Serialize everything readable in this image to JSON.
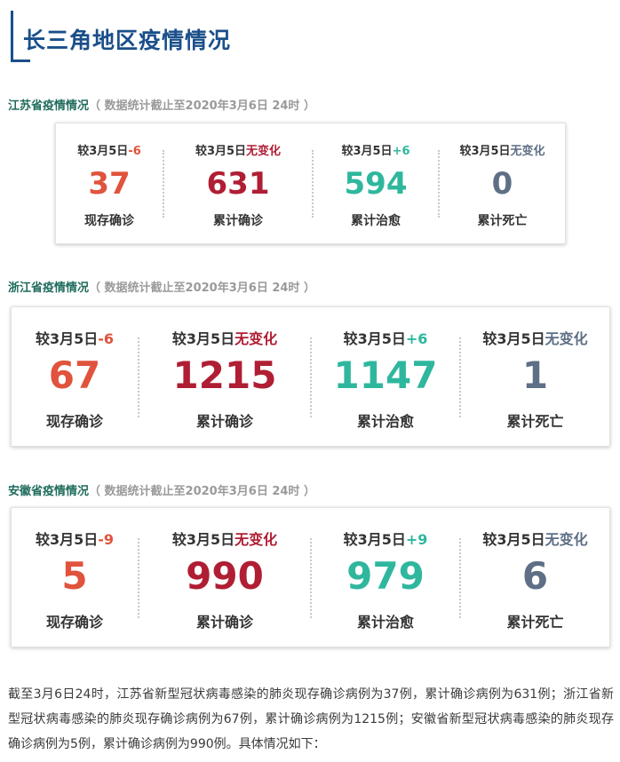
{
  "title": "长三角地区疫情情况",
  "sections": [
    {
      "name": "江苏省疫情情况",
      "note": "（ 数据统计截止至2020年3月6日 24时 ）",
      "stats": [
        {
          "prefix": "较3月5日",
          "delta": "-6",
          "value": "37",
          "label": "现存确诊"
        },
        {
          "prefix": "较3月5日",
          "delta": "无变化",
          "value": "631",
          "label": "累计确诊"
        },
        {
          "prefix": "较3月5日",
          "delta": "+6",
          "value": "594",
          "label": "累计治愈"
        },
        {
          "prefix": "较3月5日",
          "delta": "无变化",
          "value": "0",
          "label": "累计死亡"
        }
      ]
    },
    {
      "name": "浙江省疫情情况",
      "note": "（ 数据统计截止至2020年3月6日 24时 ）",
      "stats": [
        {
          "prefix": "较3月5日",
          "delta": "-6",
          "value": "67",
          "label": "现存确诊"
        },
        {
          "prefix": "较3月5日",
          "delta": "无变化",
          "value": "1215",
          "label": "累计确诊"
        },
        {
          "prefix": "较3月5日",
          "delta": "+6",
          "value": "1147",
          "label": "累计治愈"
        },
        {
          "prefix": "较3月5日",
          "delta": "无变化",
          "value": "1",
          "label": "累计死亡"
        }
      ]
    },
    {
      "name": "安徽省疫情情况",
      "note": "（ 数据统计截止至2020年3月6日 24时 ）",
      "stats": [
        {
          "prefix": "较3月5日",
          "delta": "-9",
          "value": "5",
          "label": "现存确诊"
        },
        {
          "prefix": "较3月5日",
          "delta": "无变化",
          "value": "990",
          "label": "累计确诊"
        },
        {
          "prefix": "较3月5日",
          "delta": "+9",
          "value": "979",
          "label": "累计治愈"
        },
        {
          "prefix": "较3月5日",
          "delta": "无变化",
          "value": "6",
          "label": "累计死亡"
        }
      ]
    }
  ],
  "paragraph": "截至3月6日24时，江苏省新型冠状病毒感染的肺炎现存确诊病例为37例，累计确诊病例为631例；浙江省新型冠状病毒感染的肺炎现存确诊病例为67例，累计确诊病例为1215例；安徽省新型冠状病毒感染的肺炎现存确诊病例为5例，累计确诊病例为990例。具体情况如下：",
  "colors": {
    "title": "#1a4f8a",
    "section_name": "#1f6b5c",
    "note": "#9a9a9a",
    "current": "#e0533c",
    "cumulative": "#b01e34",
    "cured": "#2fb79e",
    "death": "#5e6f86"
  }
}
